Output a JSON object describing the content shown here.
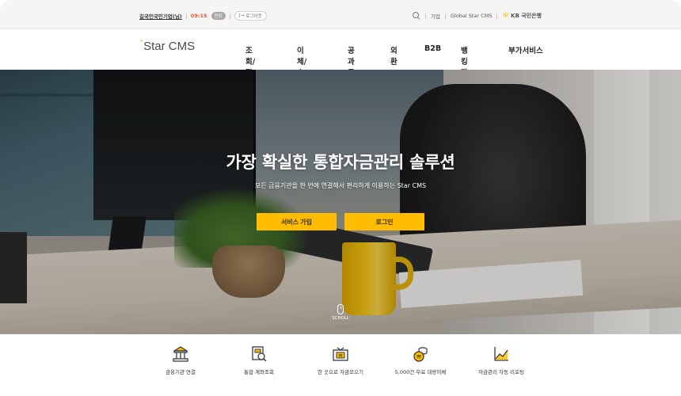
{
  "topbar": {
    "user_name": "길국민국민기업(님)",
    "timer": "09:15",
    "extend_label": "연장",
    "logout_label": "로그아웃",
    "links": [
      "기업",
      "Global Star CMS"
    ],
    "bank_name": "KB 국민은행"
  },
  "nav": {
    "brand": "Star CMS",
    "menu": [
      "조회/집금",
      "이체/수납",
      "공과금",
      "외환",
      "B2B",
      "뱅킹관리",
      "부가서비스"
    ]
  },
  "hero": {
    "title": "가장 확실한 통합자금관리 솔루션",
    "subtitle": "모든 금융기관을 한 번에 연결해서 편리하게 이용하는 Star CMS",
    "join_label": "서비스 가입",
    "login_label": "로그인",
    "scroll_label": "SCROLL"
  },
  "features": [
    {
      "label": "금융기관 연결",
      "icon": "bank-icon"
    },
    {
      "label": "통합 계좌조회",
      "icon": "account-search-icon"
    },
    {
      "label": "한 곳으로 자금모으기",
      "icon": "fund-collect-icon"
    },
    {
      "label": "5,000건 무료 대량이체",
      "icon": "bulk-transfer-icon"
    },
    {
      "label": "자금관리 자동 리포팅",
      "icon": "report-chart-icon"
    }
  ],
  "colors": {
    "accent": "#ffbc00",
    "timer": "#e0563a",
    "icon_stroke": "#3a3a3a"
  }
}
